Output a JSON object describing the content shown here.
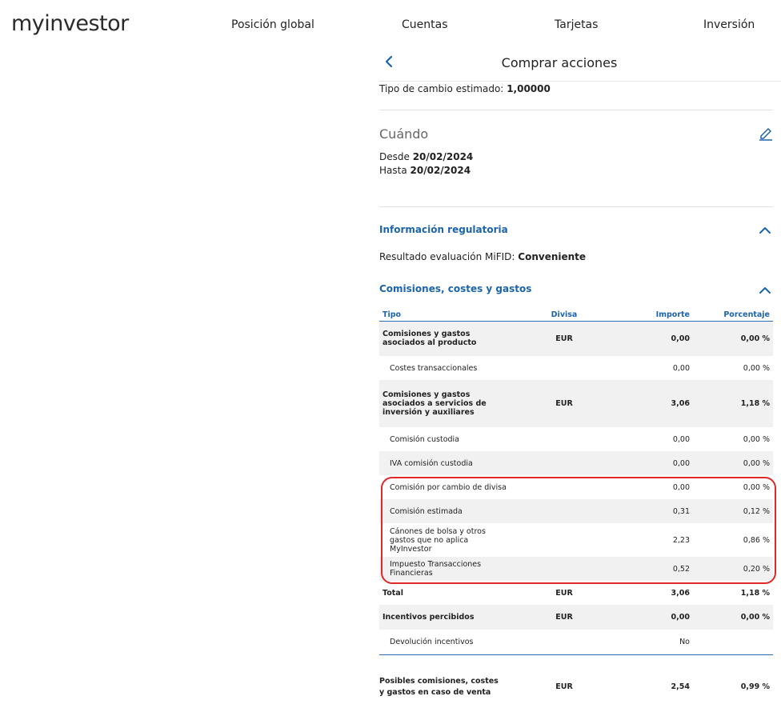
{
  "brand": {
    "logo_text": "myinvestor"
  },
  "nav": {
    "items": [
      "Posición global",
      "Cuentas",
      "Tarjetas",
      "Inversión"
    ]
  },
  "header": {
    "title": "Comprar acciones"
  },
  "exchange": {
    "label": "Tipo de cambio estimado:",
    "value": "1,00000"
  },
  "when": {
    "title": "Cuándo",
    "from_label": "Desde",
    "from_value": "20/02/2024",
    "to_label": "Hasta",
    "to_value": "20/02/2024"
  },
  "regulatory": {
    "title": "Información regulatoria",
    "mifid_label": "Resultado evaluación MiFID:",
    "mifid_value": "Conveniente"
  },
  "costs": {
    "title": "Comisiones, costes y gastos",
    "headers": {
      "type": "Tipo",
      "currency": "Divisa",
      "amount": "Importe",
      "percent": "Porcentaje"
    },
    "rows": [
      {
        "label": "Comisiones y gastos asociados al producto",
        "currency": "EUR",
        "amount": "0,00",
        "percent": "0,00 %"
      },
      {
        "label": "Costes transaccionales",
        "currency": "",
        "amount": "0,00",
        "percent": "0,00 %"
      },
      {
        "label": "Comisiones y gastos asociados a servicios de inversión y auxiliares",
        "currency": "EUR",
        "amount": "3,06",
        "percent": "1,18 %"
      },
      {
        "label": "Comisión custodia",
        "currency": "",
        "amount": "0,00",
        "percent": "0,00 %"
      },
      {
        "label": "IVA comisión custodia",
        "currency": "",
        "amount": "0,00",
        "percent": "0,00 %"
      },
      {
        "label": "Comisión por cambio de divisa",
        "currency": "",
        "amount": "0,00",
        "percent": "0,00 %"
      },
      {
        "label": "Comisión estimada",
        "currency": "",
        "amount": "0,31",
        "percent": "0,12 %"
      },
      {
        "label": "Cánones de bolsa y otros gastos que no aplica MyInvestor",
        "currency": "",
        "amount": "2,23",
        "percent": "0,86 %"
      },
      {
        "label": "Impuesto Transacciones Financieras",
        "currency": "",
        "amount": "0,52",
        "percent": "0,20 %"
      },
      {
        "label": "Total",
        "currency": "EUR",
        "amount": "3,06",
        "percent": "1,18 %"
      },
      {
        "label": "Incentivos percibidos",
        "currency": "EUR",
        "amount": "0,00",
        "percent": "0,00 %"
      },
      {
        "label": "Devolución incentivos",
        "currency": "",
        "amount": "No",
        "percent": ""
      }
    ]
  },
  "sale": {
    "label": "Posibles comisiones, costes y gastos en caso de venta",
    "currency": "EUR",
    "amount": "2,54",
    "percent": "0,99 %"
  },
  "colors": {
    "accent": "#1c64ab",
    "highlight": "#e02828"
  },
  "icons": {
    "back": "chevron-left-icon",
    "edit": "pencil-icon",
    "collapse": "chevron-up-icon"
  }
}
